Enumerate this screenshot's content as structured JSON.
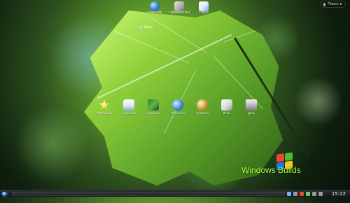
{
  "top_pill": {
    "text": "Поиск в сети"
  },
  "top_icons": [
    {
      "label": "Браузер",
      "icon": "globe-icon"
    },
    {
      "label": "Параметры системы",
      "icon": "tools-icon"
    },
    {
      "label": "Офис",
      "icon": "document-icon"
    }
  ],
  "search_hint": {
    "text": "Поиск",
    "icon": "search-icon"
  },
  "main_icons": [
    {
      "label": "Избранное",
      "icon": "star-icon"
    },
    {
      "label": "Контакты",
      "icon": "contacts-card-icon"
    },
    {
      "label": "Офисные",
      "icon": "office-icon"
    },
    {
      "label": "Интернет",
      "icon": "internet-globe-icon"
    },
    {
      "label": "Графика",
      "icon": "graphics-icon"
    },
    {
      "label": "Игры",
      "icon": "cards-icon"
    },
    {
      "label": "Диск",
      "icon": "drive-icon"
    }
  ],
  "watermark": {
    "text": "Windows Builds",
    "icon": "windows-logo-icon"
  },
  "taskbar": {
    "launcher_icon": "kde-launcher-icon",
    "tray_icons": [
      "tray-icon-1",
      "tray-icon-2",
      "tray-icon-3",
      "tray-icon-4",
      "tray-icon-5",
      "tray-icon-6"
    ],
    "clock": "15:22"
  }
}
